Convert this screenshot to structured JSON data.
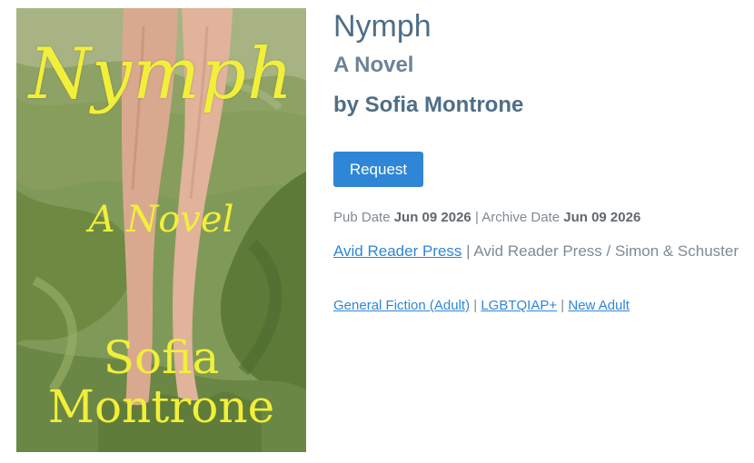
{
  "cover": {
    "title": "Nymph",
    "subtitle": "A Novel",
    "author_first": "Sofia",
    "author_last": "Montrone"
  },
  "book": {
    "title": "Nymph",
    "subtitle": "A Novel",
    "author_line": "by Sofia Montrone"
  },
  "actions": {
    "request_label": "Request"
  },
  "dates": {
    "pub_label": "Pub Date",
    "pub_value": "Jun 09 2026",
    "separator": "|",
    "archive_label": "Archive Date",
    "archive_value": "Jun 09 2026"
  },
  "publisher": {
    "imprint_link": "Avid Reader Press",
    "separator": "|",
    "full_name": "Avid Reader Press / Simon & Schuster"
  },
  "categories": {
    "items": [
      "General Fiction (Adult)",
      "LGBTQIAP+",
      "New Adult"
    ],
    "separator": "|"
  },
  "colors": {
    "title": "#4f6e87",
    "link": "#2f86d6",
    "button": "#2f86d6",
    "cover_text": "#f2ef3a"
  }
}
